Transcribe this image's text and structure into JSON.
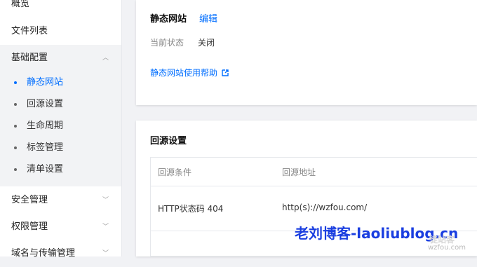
{
  "sidebar": {
    "items": [
      {
        "label": "概览"
      },
      {
        "label": "文件列表"
      },
      {
        "label": "基础配置"
      },
      {
        "label": "安全管理"
      },
      {
        "label": "权限管理"
      },
      {
        "label": "域名与传输管理"
      }
    ],
    "sub_items": [
      {
        "label": "静态网站",
        "active": true
      },
      {
        "label": "回源设置"
      },
      {
        "label": "生命周期"
      },
      {
        "label": "标签管理"
      },
      {
        "label": "清单设置"
      }
    ]
  },
  "static_site": {
    "title": "静态网站",
    "edit": "编辑",
    "status_label": "当前状态",
    "status_value": "关闭",
    "help_link": "静态网站使用帮助"
  },
  "origin": {
    "title": "回源设置",
    "columns": [
      "回源条件",
      "回源地址"
    ],
    "rows": [
      {
        "condition": "HTTP状态码 404",
        "address": "http(s)://wzfou.com/"
      }
    ]
  },
  "watermark": {
    "text": "老刘博客-laoliublog.cn",
    "stamp": "徒站客",
    "domain": "wzfou.com"
  },
  "colors": {
    "accent": "#006eff",
    "watermark": "#1a3ee0"
  }
}
